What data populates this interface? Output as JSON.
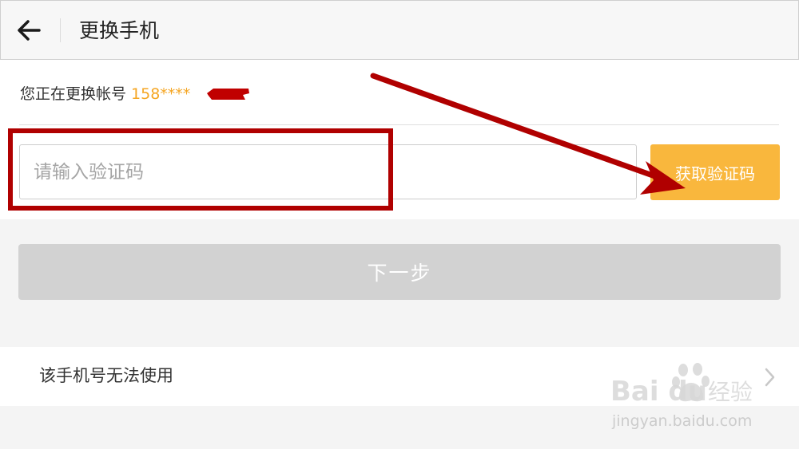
{
  "header": {
    "title": "更换手机",
    "back_icon": "arrow-left-icon"
  },
  "account": {
    "prefix": "您正在更换帐号 ",
    "number": "158****"
  },
  "verification": {
    "placeholder": "请输入验证码",
    "value": "",
    "get_code_label": "获取验证码"
  },
  "next_label": "下一步",
  "unusable": {
    "label": "该手机号无法使用",
    "chevron_icon": "chevron-right-icon"
  },
  "watermark": {
    "brand": "Bai du",
    "suffix": "经验",
    "url": "jingyan.baidu.com"
  },
  "colors": {
    "accent_orange": "#f9b73d",
    "account_number": "#f5a623",
    "annotation_red": "#b00000",
    "disabled_button": "#d2d2d2"
  }
}
